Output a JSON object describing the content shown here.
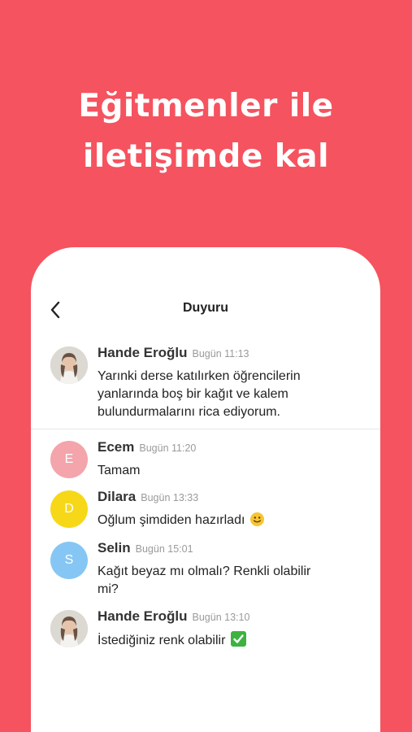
{
  "hero": {
    "line1": "Eğitmenler ile",
    "line2": "iletişimde kal"
  },
  "topbar": {
    "title": "Duyuru",
    "back_icon": "chevron-left-icon"
  },
  "announcement": {
    "name": "Hande Eroğlu",
    "time": "Bugün 11:13",
    "text": "Yarınki derse katılırken öğrencilerin yanlarında boş bir kağıt ve kalem bulundurmalarını rica ediyorum."
  },
  "messages": [
    {
      "name": "Ecem",
      "time": "Bugün 11:20",
      "text": "Tamam",
      "initial": "E",
      "avatar_color": "#f4a4ab"
    },
    {
      "name": "Dilara",
      "time": "Bugün 13:33",
      "text": "Oğlum şimdiden hazırladı",
      "initial": "D",
      "avatar_color": "#f6d818",
      "emoji": "slightly-smiling-face-emoji"
    },
    {
      "name": "Selin",
      "time": "Bugün 15:01",
      "text": "Kağıt beyaz mı olmalı? Renkli olabilir mi?",
      "initial": "S",
      "avatar_color": "#86c6f4"
    },
    {
      "name": "Hande Eroğlu",
      "time": "Bugün 13:10",
      "text": "İstediğiniz renk olabilir",
      "emoji": "check-mark-button-emoji"
    }
  ],
  "colors": {
    "background": "#f5535f",
    "card": "#ffffff"
  }
}
